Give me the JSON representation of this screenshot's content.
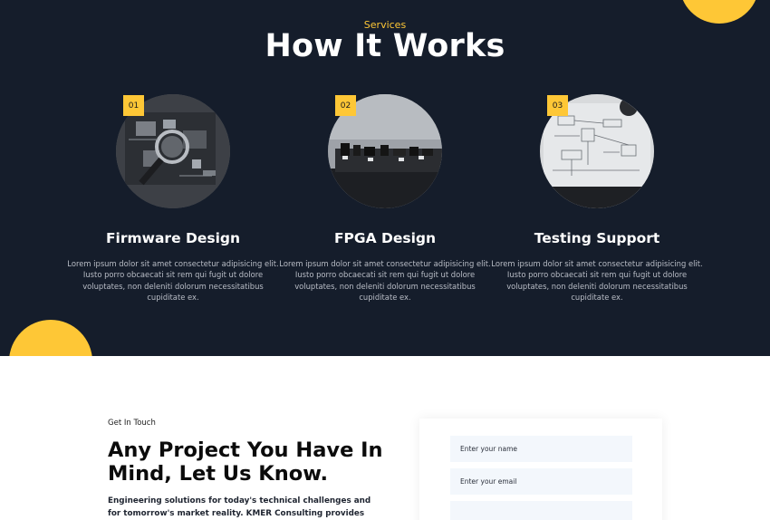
{
  "services": {
    "eyebrow": "Services",
    "title": "How It Works",
    "steps": [
      {
        "number": "01",
        "title": "Firmware Design",
        "text": "Lorem ipsum dolor sit amet consectetur adipisicing elit. Iusto porro obcaecati sit rem qui fugit ut dolore voluptates, non deleniti dolorum necessitatibus cupiditate ex."
      },
      {
        "number": "02",
        "title": "FPGA Design",
        "text": "Lorem ipsum dolor sit amet consectetur adipisicing elit. Iusto porro obcaecati sit rem qui fugit ut dolore voluptates, non deleniti dolorum necessitatibus cupiditate ex."
      },
      {
        "number": "03",
        "title": "Testing Support",
        "text": "Lorem ipsum dolor sit amet consectetur adipisicing elit. Iusto porro obcaecati sit rem qui fugit ut dolore voluptates, non deleniti dolorum necessitatibus cupiditate ex."
      }
    ]
  },
  "contact": {
    "eyebrow": "Get In Touch",
    "heading": "Any Project You Have In Mind, Let Us Know.",
    "description": "Engineering solutions for today's technical challenges and for tomorrow's market reality. KMER Consulting provides the right",
    "form": {
      "name_placeholder": "Enter your name",
      "email_placeholder": "Enter your email",
      "third_placeholder": ""
    }
  },
  "colors": {
    "dark_bg": "#151d2b",
    "accent": "#fec736",
    "field_bg": "#f3f7fc"
  }
}
